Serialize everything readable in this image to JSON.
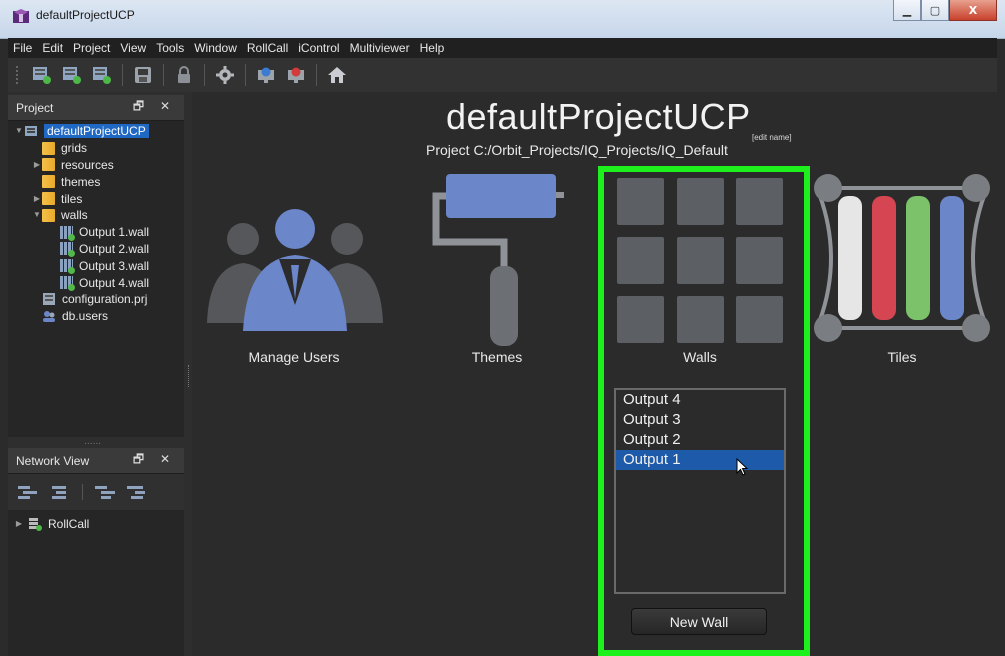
{
  "window": {
    "title": "defaultProjectUCP",
    "controls": [
      "minimize",
      "maximize",
      "close"
    ],
    "close_glyph": "X"
  },
  "menubar": [
    "File",
    "Edit",
    "Project",
    "View",
    "Tools",
    "Window",
    "RollCall",
    "iControl",
    "Multiviewer",
    "Help"
  ],
  "toolbar": {
    "icons": [
      "new-grid-icon",
      "new-item-icon",
      "new-wall-icon",
      "save-icon",
      "lock-icon",
      "settings-icon",
      "monitor-add-icon",
      "monitor-remove-icon",
      "home-icon"
    ]
  },
  "project_panel": {
    "title": "Project",
    "controls_glyph": "🗗 ✕",
    "tree": [
      {
        "label": "defaultProjectUCP",
        "level": 0,
        "icon": "project-icon",
        "arrow": "▼",
        "selected": true
      },
      {
        "label": "grids",
        "level": 1,
        "icon": "folder-icon",
        "arrow": ""
      },
      {
        "label": "resources",
        "level": 1,
        "icon": "folder-icon",
        "arrow": "▶"
      },
      {
        "label": "themes",
        "level": 1,
        "icon": "folder-icon",
        "arrow": ""
      },
      {
        "label": "tiles",
        "level": 1,
        "icon": "folder-icon",
        "arrow": "▶"
      },
      {
        "label": "walls",
        "level": 1,
        "icon": "folder-icon",
        "arrow": "▼"
      },
      {
        "label": "Output 1.wall",
        "level": 2,
        "icon": "wall-file-icon",
        "arrow": ""
      },
      {
        "label": "Output 2.wall",
        "level": 2,
        "icon": "wall-file-icon",
        "arrow": ""
      },
      {
        "label": "Output 3.wall",
        "level": 2,
        "icon": "wall-file-icon",
        "arrow": ""
      },
      {
        "label": "Output 4.wall",
        "level": 2,
        "icon": "wall-file-icon",
        "arrow": ""
      },
      {
        "label": "configuration.prj",
        "level": 1,
        "icon": "config-file-icon",
        "arrow": ""
      },
      {
        "label": "db.users",
        "level": 1,
        "icon": "users-file-icon",
        "arrow": ""
      }
    ]
  },
  "network_panel": {
    "title": "Network View",
    "controls_glyph": "🗗 ✕",
    "splitter_dots": "......",
    "tree": [
      {
        "label": "RollCall",
        "arrow": "▶"
      }
    ]
  },
  "main": {
    "project_name": "defaultProjectUCP",
    "edit_name": "[edit name]",
    "project_path": "Project C:/Orbit_Projects/IQ_Projects/IQ_Default",
    "sections": {
      "users": "Manage Users",
      "themes": "Themes",
      "walls": "Walls",
      "tiles": "Tiles"
    },
    "wall_outputs": [
      {
        "label": "Output 4",
        "selected": false
      },
      {
        "label": "Output 3",
        "selected": false
      },
      {
        "label": "Output 2",
        "selected": false
      },
      {
        "label": "Output 1",
        "selected": true
      }
    ],
    "new_wall_button": "New Wall"
  },
  "colors": {
    "highlight": "#1ef01e",
    "selection": "#1e5aaa",
    "accent_blue": "#6b86c9",
    "tile_red": "#d64552",
    "tile_green": "#7cc26a",
    "tile_white": "#e6e6e6",
    "tile_blue": "#6b86c9"
  }
}
